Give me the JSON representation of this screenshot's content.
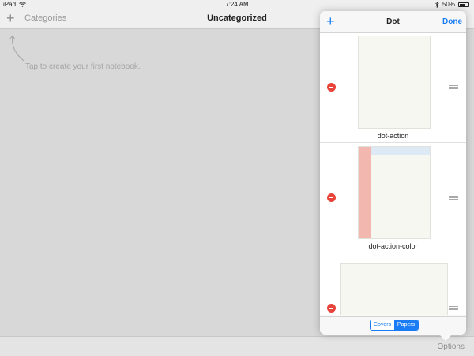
{
  "status_bar": {
    "device": "iPad",
    "time": "7:24 AM",
    "battery": "50%"
  },
  "nav": {
    "add_label": "+",
    "categories_label": "Categories",
    "title": "Uncategorized"
  },
  "main": {
    "hint": "Tap to create your first notebook."
  },
  "bottom_bar": {
    "options_label": "Options"
  },
  "popover": {
    "add_label": "+",
    "title": "Dot",
    "done_label": "Done",
    "papers": [
      {
        "name": "dot-action"
      },
      {
        "name": "dot-action-color"
      },
      {
        "name": ""
      }
    ],
    "segments": [
      {
        "label": "Covers",
        "selected": false
      },
      {
        "label": "Papers",
        "selected": true
      }
    ]
  },
  "colors": {
    "accent": "#1a7cf5",
    "delete": "#e8443a",
    "paper_sidebar": "#f2b8b0",
    "paper_header": "#dde9f5"
  },
  "icons": {
    "wifi": "wifi-icon",
    "bluetooth": "bluetooth-icon",
    "battery": "battery-icon",
    "arrow": "curved-arrow-icon"
  }
}
